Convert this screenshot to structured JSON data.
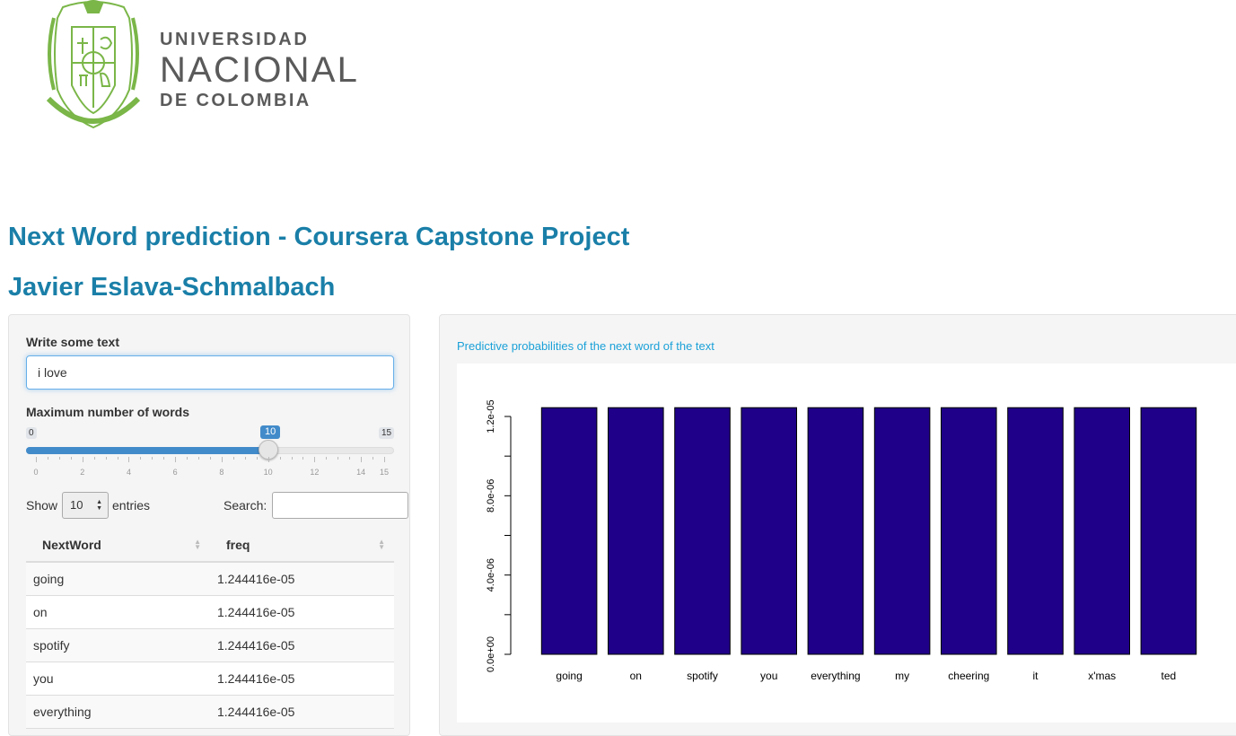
{
  "logo": {
    "line1": "UNIVERSIDAD",
    "line2": "NACIONAL",
    "line3": "DE COLOMBIA",
    "color": "#7ab648"
  },
  "page": {
    "title": "Next Word prediction - Coursera Capstone Project",
    "author": "Javier Eslava-Schmalbach"
  },
  "sidebar": {
    "text_label": "Write some text",
    "text_value": "i love",
    "slider_label": "Maximum number of words",
    "slider": {
      "min": 0,
      "max": 15,
      "value": 10,
      "tick_labels": [
        "0",
        "2",
        "4",
        "6",
        "8",
        "10",
        "12",
        "14",
        "15"
      ]
    },
    "table": {
      "show_label": "Show",
      "page_length": "10",
      "entries_label": "entries",
      "search_label": "Search:",
      "columns": [
        "NextWord",
        "freq"
      ],
      "rows": [
        [
          "going",
          "1.244416e-05"
        ],
        [
          "on",
          "1.244416e-05"
        ],
        [
          "spotify",
          "1.244416e-05"
        ],
        [
          "you",
          "1.244416e-05"
        ],
        [
          "everything",
          "1.244416e-05"
        ]
      ]
    }
  },
  "main": {
    "plot_title": "Predictive probabilities of the next word of the text"
  },
  "chart_data": {
    "type": "bar",
    "categories": [
      "going",
      "on",
      "spotify",
      "you",
      "everything",
      "my",
      "cheering",
      "it",
      "x'mas",
      "ted"
    ],
    "values": [
      1.244416e-05,
      1.244416e-05,
      1.244416e-05,
      1.244416e-05,
      1.244416e-05,
      1.244416e-05,
      1.244416e-05,
      1.244416e-05,
      1.244416e-05,
      1.244416e-05
    ],
    "ylim": [
      0,
      1.2e-05
    ],
    "y_tick_labels": [
      "0.0e+00",
      "4.0e-06",
      "8.0e-06",
      "1.2e-05"
    ],
    "y_tick_values": [
      0,
      4e-06,
      8e-06,
      1.2e-05
    ],
    "bar_color": "#1f0088",
    "grid": false
  }
}
